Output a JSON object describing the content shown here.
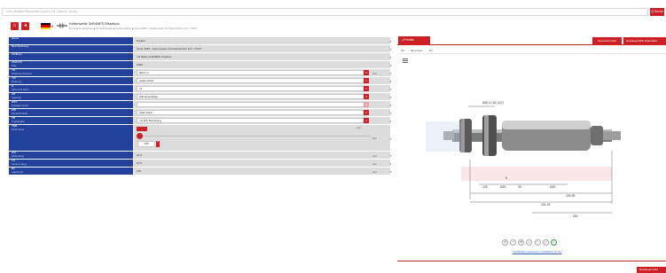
{
  "search": {
    "placeholder": "Unter Bedarfs-Stichwörtern suchen z.B. Zahnrad, Bolzen...",
    "button_label": "Q  Suche"
  },
  "header": {
    "title": "Kettenwelle 3xR4NFS Ritzelbox",
    "breadcrumb": [
      "Home",
      "Kupplungen",
      "Antriebswellen",
      "Kettenwellen",
      "Serie 2025 - Kettenwelle mit Kettenritzeln 1/2\" x 5/16\""
    ],
    "language_flag": "DE"
  },
  "colors": {
    "accent": "#cc1f26",
    "label_bg": "#23419a",
    "value_bg": "#dcdcdc"
  },
  "rows": [
    {
      "label": "Name",
      "sub": "",
      "value": "Projekt",
      "type": "text",
      "lock": true
    },
    {
      "label": "Beschreibung",
      "sub": "",
      "value": "Serie 2025 - Kettenwelle mit Kettenritzeln 1/2\" x 5/16\"",
      "type": "text",
      "lock": true
    },
    {
      "label": "Attribute",
      "sub": "",
      "value": "mit Welle 3xR4NFS ritzelbox",
      "type": "text",
      "lock": true
    },
    {
      "label": "ANZAHL",
      "sub": "Zeile",
      "value": "1000",
      "type": "text",
      "lock": true
    },
    {
      "label": "TB",
      "sub": "Wellendurchmesser",
      "value": "Ø20.0 d",
      "type": "dropdown",
      "unit": "mm",
      "lock": true
    },
    {
      "label": "TW",
      "sub": "Wellentyp",
      "value": "Glatte Welle",
      "type": "dropdown",
      "unit": "",
      "lock": true
    },
    {
      "label": "S",
      "sub": "Zähnezahl Ritzel",
      "value": "15",
      "type": "dropdown",
      "unit": "",
      "lock": true
    },
    {
      "label": "WT",
      "sub": "Lagerung",
      "value": "Rillenkugellager",
      "type": "dropdown",
      "unit": "",
      "lock": true
    },
    {
      "label": "WFT",
      "sub": "Feinlager Größe",
      "value": "",
      "type": "dropdown-disabled",
      "unit": "",
      "lock": true
    },
    {
      "label": "WB",
      "sub": "Werkstoff Welle",
      "value": "Stahl blank",
      "type": "dropdown",
      "unit": "",
      "lock": true
    },
    {
      "label": "TB",
      "sub": "Tragfähigkeit",
      "value": "mit DIN Bestellung",
      "type": "dropdown",
      "unit": "",
      "lock": true
    },
    {
      "label": "TBR",
      "sub": "Wellenlänge",
      "value": "150",
      "type": "slider",
      "unit": "mm",
      "lock": true
    },
    {
      "label": "WO",
      "sub": "Wellenlänge",
      "value": "91,5",
      "type": "text",
      "unit": "mm",
      "lock": true
    },
    {
      "label": "TS",
      "sub": "Gesamt Länge",
      "value": "87,5",
      "type": "text",
      "unit": "mm",
      "lock": true
    },
    {
      "label": "B1",
      "sub": "Lagerbreite",
      "value": "150",
      "type": "text",
      "unit": "mm",
      "lock": true
    }
  ],
  "slider": {
    "header_unit": "mm",
    "number_value": "150",
    "fraction": 0.0
  },
  "preview": {
    "tab_label": "Preview",
    "subtabs": [
      "2D",
      "Dimension",
      "3D"
    ],
    "btn_cad": "Download CAD",
    "btn_pdf": "Download PDF Datenblatt",
    "dimensions": [
      "Ø40 Z=15 (1/2\")",
      "105",
      "Ø20",
      "25",
      "Ø20",
      "150.95",
      "5",
      "151.25",
      "260"
    ],
    "powered_by": "CADENAS powered by CADENAS GmbH",
    "corner_btn": "Download CAD"
  },
  "toolbar": {
    "icons": [
      "rotate-icon",
      "zoom-icon",
      "pan-icon",
      "measure-icon",
      "fit-icon",
      "fullscreen-icon",
      "settings-icon"
    ]
  }
}
